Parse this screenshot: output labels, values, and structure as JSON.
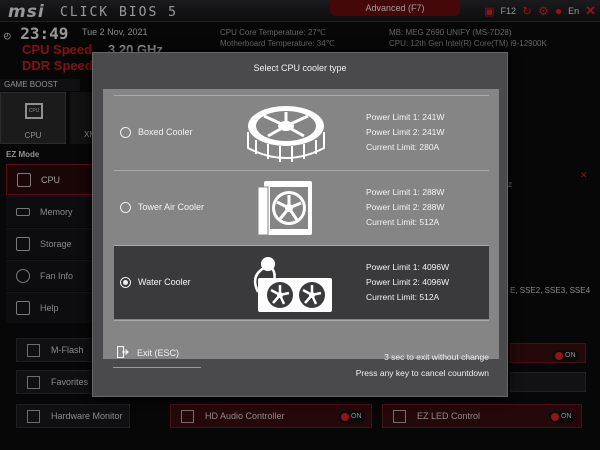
{
  "header": {
    "brand": "msi",
    "product": "CLICK BIOS 5",
    "advanced_tab": "Advanced (F7)",
    "f12_label": "F12",
    "language": "En",
    "time": "23:49",
    "date": "Tue  2 Nov, 2021",
    "cpu_speed_label": "CPU Speed",
    "cpu_speed_value": "3.20 GHz",
    "ddr_speed_label": "DDR Speed",
    "cpu_temp": "CPU Core Temperature: 27℃",
    "mb_temp": "Motherboard Temperature: 34℃",
    "mb_model": "MB: MEG Z690 UNIFY (MS-7D28)",
    "cpu_model": "CPU: 12th Gen Intel(R) Core(TM) i9-12900K"
  },
  "game_boost": {
    "label": "GAME BOOST",
    "tiles": [
      {
        "label": "CPU"
      },
      {
        "label": "XM"
      }
    ]
  },
  "ez_mode": {
    "label": "EZ Mode",
    "items": [
      {
        "label": "CPU",
        "icon": "cpu-icon",
        "active": true
      },
      {
        "label": "Memory",
        "icon": "memory-icon",
        "active": false
      },
      {
        "label": "Storage",
        "icon": "storage-icon",
        "active": false
      },
      {
        "label": "Fan Info",
        "icon": "fan-icon",
        "active": false
      },
      {
        "label": "Help",
        "icon": "help-icon",
        "active": false
      }
    ]
  },
  "bottom_tiles": {
    "mflash": "M-Flash",
    "favorites": "Favorites",
    "hardware_monitor": "Hardware Monitor",
    "hd_audio": "HD Audio Controller",
    "ez_led": "EZ LED Control",
    "on_label": "ON"
  },
  "background_text": {
    "sse": "E, SSE2, SSE3, SSE4",
    "z": "z"
  },
  "modal": {
    "title": "Select CPU cooler type",
    "options": [
      {
        "name": "Boxed Cooler",
        "selected": false,
        "power_limit_1": "Power Limit 1: 241W",
        "power_limit_2": "Power Limit 2: 241W",
        "current_limit": "Current Limit: 280A"
      },
      {
        "name": "Tower Air Cooler",
        "selected": false,
        "power_limit_1": "Power Limit 1: 288W",
        "power_limit_2": "Power Limit 2: 288W",
        "current_limit": "Current Limit: 512A"
      },
      {
        "name": "Water Cooler",
        "selected": true,
        "power_limit_1": "Power Limit 1: 4096W",
        "power_limit_2": "Power Limit 2: 4096W",
        "current_limit": "Current Limit: 512A"
      }
    ],
    "exit_label": "Exit (ESC)",
    "countdown_text": "3   sec to exit without change",
    "cancel_text": "Press any key to cancel countdown"
  },
  "colors": {
    "accent": "#c81e1e",
    "modal_bg": "#858585",
    "selected_row": "#3a3a3c"
  }
}
